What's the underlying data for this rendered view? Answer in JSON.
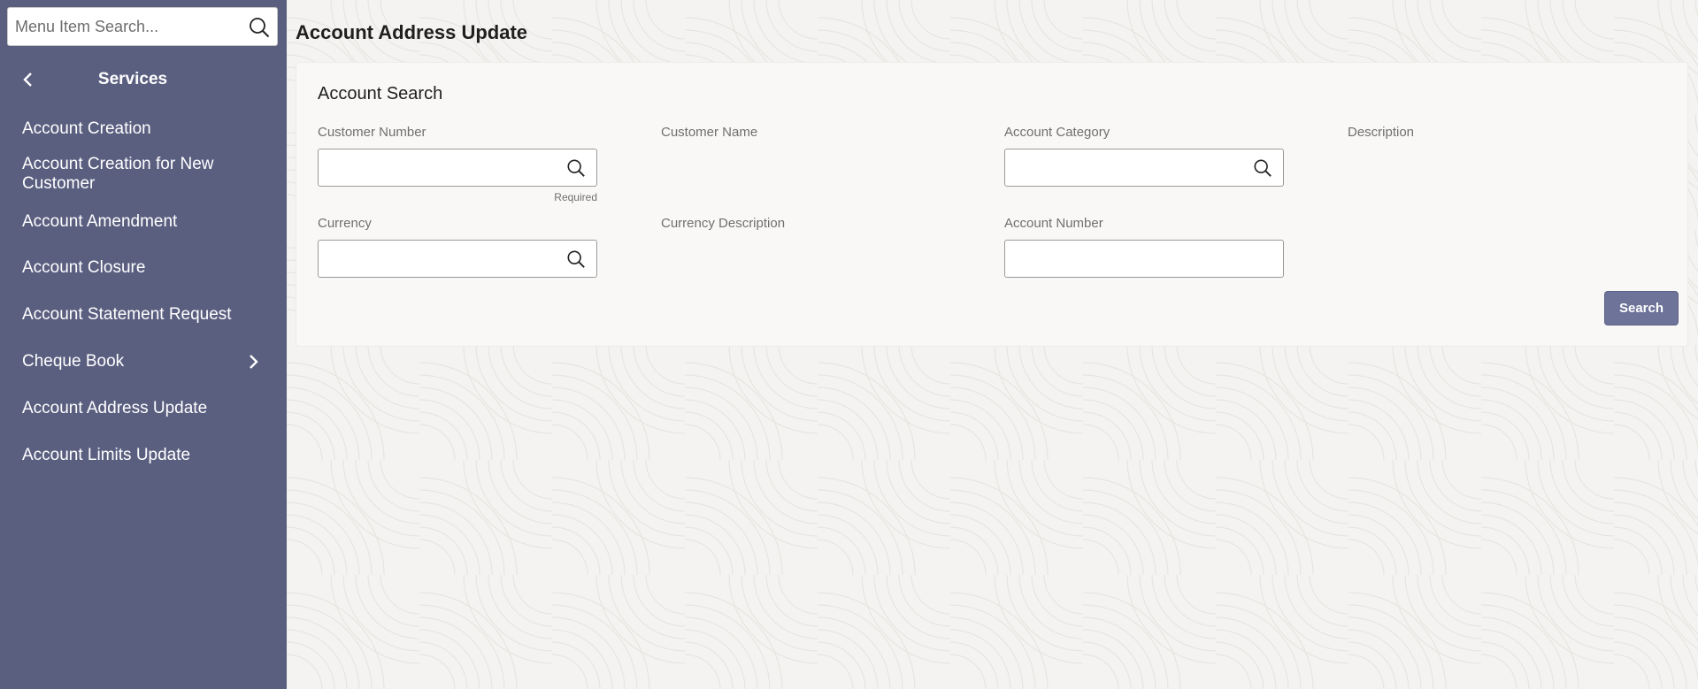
{
  "sidebar": {
    "search": {
      "placeholder": "Menu Item Search...",
      "icon": "search-icon"
    },
    "header": {
      "title": "Services",
      "back_icon": "chevron-left-icon"
    },
    "items": [
      {
        "label": "Account Creation"
      },
      {
        "label": "Account Creation for New Customer"
      },
      {
        "label": "Account Amendment"
      },
      {
        "label": "Account Closure"
      },
      {
        "label": "Account Statement Request"
      },
      {
        "label": "Cheque Book",
        "icon": "chevron-right-icon"
      },
      {
        "label": "Account Address Update"
      },
      {
        "label": "Account Limits Update"
      }
    ]
  },
  "main": {
    "page_title": "Account Address Update",
    "panel": {
      "title": "Account Search",
      "fields": {
        "customer_number": {
          "label": "Customer Number",
          "value": "",
          "hint": "Required",
          "icon": "search-icon"
        },
        "customer_name": {
          "label": "Customer Name"
        },
        "account_category": {
          "label": "Account Category",
          "value": "",
          "icon": "search-icon"
        },
        "description": {
          "label": "Description"
        },
        "currency": {
          "label": "Currency",
          "value": "",
          "icon": "search-icon"
        },
        "currency_description": {
          "label": "Currency Description"
        },
        "account_number": {
          "label": "Account Number",
          "value": ""
        }
      },
      "search_button": "Search"
    }
  },
  "colors": {
    "sidebar_bg": "#5a5f80",
    "main_bg": "#f4f3f1",
    "panel_bg": "#f9f8f6",
    "button_bg": "#6d7399"
  }
}
